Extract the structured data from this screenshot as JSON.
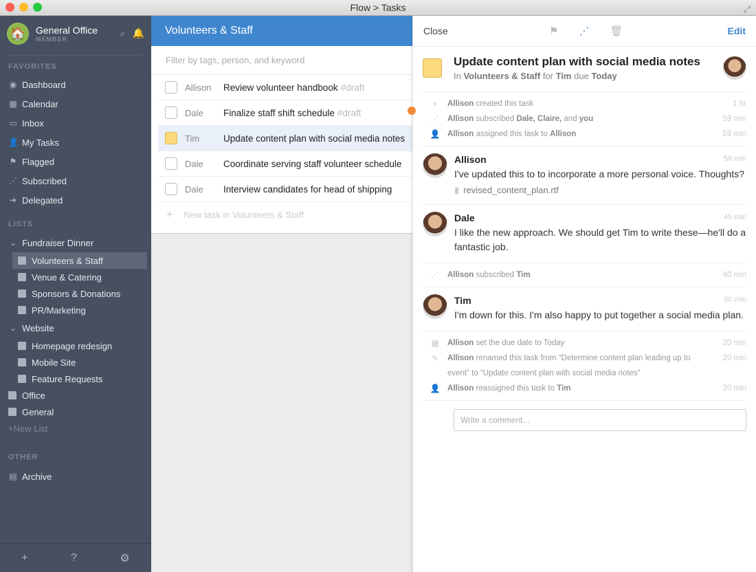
{
  "window": {
    "title": "Flow > Tasks"
  },
  "org": {
    "name": "General Office",
    "role": "MEMBER"
  },
  "sidebar": {
    "favorites_label": "FAVORITES",
    "favorites": [
      {
        "label": "Dashboard",
        "icon": "dashboard-icon",
        "glyph": "◉"
      },
      {
        "label": "Calendar",
        "icon": "calendar-icon",
        "glyph": "▦"
      },
      {
        "label": "Inbox",
        "icon": "inbox-icon",
        "glyph": "▭"
      },
      {
        "label": "My Tasks",
        "icon": "person-icon",
        "glyph": "👤"
      },
      {
        "label": "Flagged",
        "icon": "flag-icon",
        "glyph": "⚑"
      },
      {
        "label": "Subscribed",
        "icon": "rss-icon",
        "glyph": "⋰"
      },
      {
        "label": "Delegated",
        "icon": "delegated-icon",
        "glyph": "➜"
      }
    ],
    "lists_label": "LISTS",
    "groups": [
      {
        "label": "Fundraiser Dinner",
        "items": [
          "Volunteers & Staff",
          "Venue & Catering",
          "Sponsors & Donations",
          "PR/Marketing"
        ]
      },
      {
        "label": "Website",
        "items": [
          "Homepage redesign",
          "Mobile Site",
          "Feature Requests"
        ]
      }
    ],
    "singles": [
      "Office",
      "General"
    ],
    "new_list": "New List",
    "other_label": "OTHER",
    "archive": "Archive"
  },
  "middle": {
    "title": "Volunteers & Staff",
    "filter_placeholder": "Filter by tags, person, and keyword",
    "tasks": [
      {
        "who": "Allison",
        "title": "Review volunteer handbook",
        "tag": "#draft",
        "selected": false
      },
      {
        "who": "Dale",
        "title": "Finalize staff shift schedule",
        "tag": "#draft",
        "selected": false
      },
      {
        "who": "Tim",
        "title": "Update content plan with social media notes",
        "tag": "",
        "selected": true
      },
      {
        "who": "Dale",
        "title": "Coordinate serving staff volunteer schedule",
        "tag": "",
        "selected": false
      },
      {
        "who": "Dale",
        "title": "Interview candidates for head of shipping",
        "tag": "",
        "selected": false
      }
    ],
    "new_task": "New task in Volunteers & Staff"
  },
  "detail": {
    "close": "Close",
    "edit": "Edit",
    "title": "Update content plan with social media notes",
    "sub": {
      "in": "In",
      "list": "Volunteers & Staff",
      "for": "for",
      "person": "Tim",
      "due": "due",
      "date": "Today"
    },
    "blocks": [
      {
        "type": "activity",
        "items": [
          {
            "icon": "plus-icon",
            "glyph": "+",
            "parts": [
              [
                "Allison",
                1
              ],
              [
                " created this task",
                0
              ]
            ],
            "time": "1 hr"
          },
          {
            "icon": "rss-icon",
            "glyph": "⋰",
            "parts": [
              [
                "Allison",
                1
              ],
              [
                " subscribed ",
                0
              ],
              [
                "Dale, Claire,",
                1
              ],
              [
                " and ",
                0
              ],
              [
                "you",
                1
              ]
            ],
            "time": "59 min"
          },
          {
            "icon": "person-icon",
            "glyph": "👤",
            "parts": [
              [
                "Allison",
                1
              ],
              [
                " assigned this task to ",
                0
              ],
              [
                "Allison",
                1
              ]
            ],
            "time": "59 min"
          }
        ]
      },
      {
        "type": "comment",
        "name": "Allison",
        "text": "I've updated this to to incorporate a more personal voice. Thoughts?",
        "time": "58 min",
        "attachment": "revised_content_plan.rtf"
      },
      {
        "type": "comment",
        "name": "Dale",
        "text": "I like the new approach. We should get Tim to write these—he'll do a fantastic job.",
        "time": "45 min"
      },
      {
        "type": "activity",
        "items": [
          {
            "icon": "rss-icon",
            "glyph": "⋰",
            "parts": [
              [
                "Allison",
                1
              ],
              [
                " subscribed ",
                0
              ],
              [
                "Tim",
                1
              ]
            ],
            "time": "40 min"
          }
        ]
      },
      {
        "type": "comment",
        "name": "Tim",
        "text": "I'm down for this. I'm also happy to put together a social media plan.",
        "time": "30 min"
      },
      {
        "type": "activity",
        "items": [
          {
            "icon": "calendar-icon",
            "glyph": "▦",
            "parts": [
              [
                "Allison",
                1
              ],
              [
                " set the due date to Today",
                0
              ]
            ],
            "time": "20 min"
          },
          {
            "icon": "pencil-icon",
            "glyph": "✎",
            "parts": [
              [
                "Allison",
                1
              ],
              [
                " renamed this task from “Determine content plan leading up to event” to “Update content plan with social media notes”",
                0
              ]
            ],
            "time": "20 min"
          },
          {
            "icon": "person-icon",
            "glyph": "👤",
            "parts": [
              [
                "Allison",
                1
              ],
              [
                " reassigned this task to ",
                0
              ],
              [
                "Tim",
                1
              ]
            ],
            "time": "20 min"
          }
        ]
      }
    ],
    "comment_placeholder": "Write a comment..."
  },
  "colors": {
    "accent": "#3f86cf",
    "sidebar": "#465060",
    "task_yellow": "#fcd97a",
    "indicator": "#f08a36"
  }
}
